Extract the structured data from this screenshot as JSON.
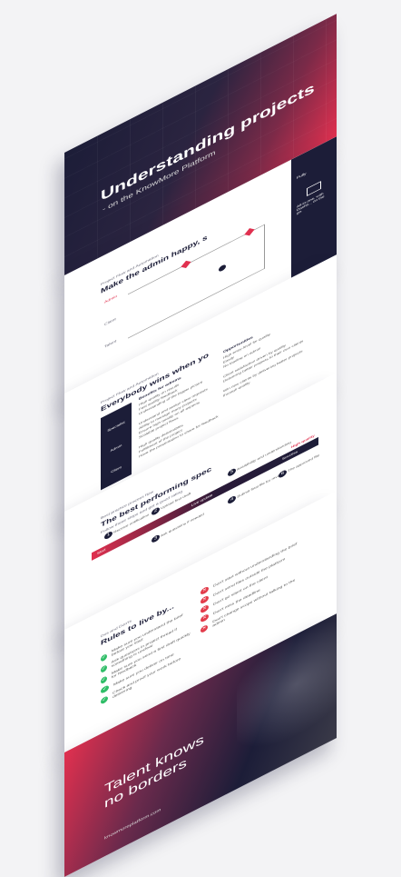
{
  "slides": [
    {
      "title": "Understanding projects",
      "subtitle": "- on the KnowMore Platform"
    },
    {
      "kicker": "Project Flow and Automation",
      "title": "Make the admin happy, s",
      "sidebar_label": "Fully ",
      "sidebar_text": "All-in-one, with Dashb... on the go.",
      "col_labels": [
        "Admin",
        "Client",
        "Talent"
      ]
    },
    {
      "kicker": "Project Flow and Automation",
      "title": "Everybody wins when yo",
      "legend_1": "Benefits for admins",
      "legend_2": "Opportunities",
      "roles": [
        "Specialist",
        "Admin",
        "Client"
      ],
      "right_points": [
        "High entry-level for quality",
        "Easily",
        "No loading on admin",
        "Client satisfaction driven by quality",
        "Delivering better projects to their own clients",
        "Win new clients by delivering better projects through quality"
      ],
      "left_points": [
        "High quality on results",
        "Fast quality feedback",
        "Understanding of the bigger picture",
        "Understand and assign clear requests",
        "Ability to manage many projects",
        "Ensure high quality on all aspects",
        "Scalable project flows",
        "High quality deliverables",
        "Fulfillment of the project",
        "Have the presentation to share for feedback"
      ]
    },
    {
      "kicker": "Best practice process flow",
      "title": "The best performing spec",
      "intro": "Follow these steps and get a good rating",
      "stages": [
        {
          "num": "1",
          "label": "Receive notification"
        },
        {
          "num": "2",
          "label": "Upload first draft"
        },
        {
          "num": "3",
          "label": "Ask questions if needed"
        },
        {
          "num": "4",
          "label": "Submit final file for review"
        },
        {
          "num": "5",
          "label": "Availability and understanding"
        },
        {
          "num": "6",
          "label": "The approved file"
        }
      ],
      "bar_labels": [
        "Start",
        "Live update",
        "Success"
      ],
      "highlight": "High quality"
    },
    {
      "kicker": "Dos and Don'ts",
      "title": "Rules to live by...",
      "dos": [
        "Make sure you understand the brief before you start",
        "Ask questions in project thread if something is unclear",
        "Make sure you send a first draft quickly for feedback",
        "Make sure you deliver on time",
        "Check and proof your work before delivering"
      ],
      "donts": [
        "Don't start without understanding the brief",
        "Don't send files outside the platform",
        "Don't go silent on the client",
        "Don't miss the deadline",
        "Don't change scope without talking to the admin"
      ]
    },
    {
      "title_line1": "Talent knows",
      "title_line2": "no borders",
      "url": "knowmoreplatform.com"
    }
  ],
  "colors": {
    "navy": "#1c1d38",
    "accent": "#e0304f",
    "green": "#2fbd67",
    "red": "#e23b4a"
  }
}
